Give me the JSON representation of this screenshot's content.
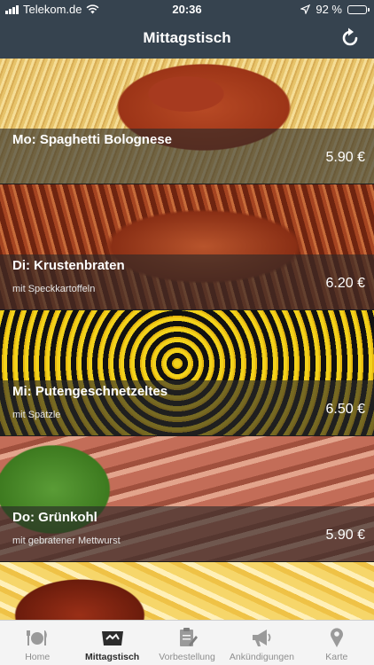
{
  "status": {
    "carrier": "Telekom.de",
    "time": "20:36",
    "battery": "92 %",
    "battery_level": 0.92
  },
  "nav": {
    "title": "Mittagstisch"
  },
  "menu": [
    {
      "title": "Mo: Spaghetti Bolognese",
      "subtitle": "",
      "price": "5.90 €"
    },
    {
      "title": "Di: Krustenbraten",
      "subtitle": "mit Speckkartoffeln",
      "price": "6.20 €"
    },
    {
      "title": "Mi: Putengeschnetzeltes",
      "subtitle": "mit Spätzle",
      "price": "6.50 €"
    },
    {
      "title": "Do: Grünkohl",
      "subtitle": "mit gebratener Mettwurst",
      "price": "5.90 €"
    }
  ],
  "tabs": [
    {
      "label": "Home",
      "icon": "fork-knife-plate-icon"
    },
    {
      "label": "Mittagstisch",
      "icon": "cloche-icon"
    },
    {
      "label": "Vorbestellung",
      "icon": "clipboard-pencil-icon"
    },
    {
      "label": "Ankündigungen",
      "icon": "megaphone-icon"
    },
    {
      "label": "Karte",
      "icon": "map-pin-icon"
    }
  ],
  "active_tab": "Mittagstisch",
  "colors": {
    "nav_background": "#36434f",
    "tab_active": "#2c2c2c",
    "tab_inactive": "#8e8e8e"
  }
}
